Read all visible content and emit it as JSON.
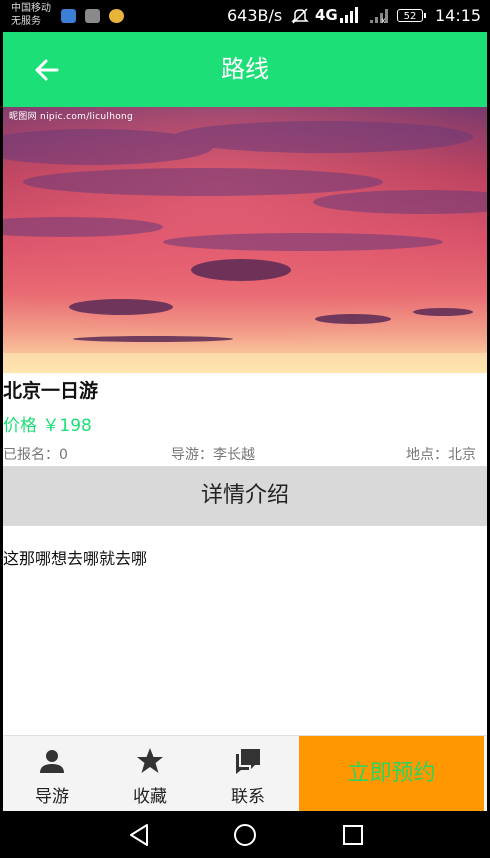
{
  "status_bar": {
    "carrier_line1": "中国移动",
    "carrier_line2": "无服务",
    "speed": "643B/s",
    "network": "4G",
    "battery": "52",
    "time": "14:15"
  },
  "header": {
    "title": "路线",
    "back_icon": "arrow-left-icon",
    "color": "#1ddf77"
  },
  "hero": {
    "watermark": "昵图网 nipic.com/liculhong"
  },
  "route": {
    "name": "北京一日游",
    "price": "价格 ￥198",
    "signed_up": "已报名：0",
    "guide": "导游：李长越",
    "location": "地点：北京"
  },
  "details": {
    "header": "详情介绍",
    "text": "这那哪想去哪就去哪"
  },
  "bottom_nav": {
    "items": [
      {
        "label": "导游",
        "icon": "person-icon"
      },
      {
        "label": "收藏",
        "icon": "star-icon"
      },
      {
        "label": "联系",
        "icon": "chat-icon"
      }
    ],
    "book_button": "立即预约",
    "book_color": "#ff9800"
  },
  "system_nav": {
    "icons": [
      "back-triangle-icon",
      "home-circle-icon",
      "recents-square-icon"
    ]
  }
}
